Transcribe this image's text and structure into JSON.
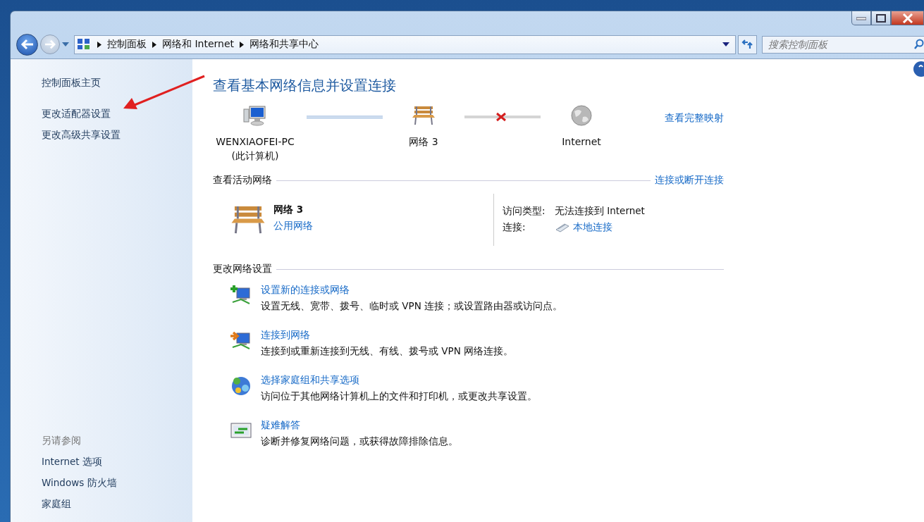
{
  "address_bar": {
    "breadcrumbs": [
      "控制面板",
      "网络和 Internet",
      "网络和共享中心"
    ],
    "search": {
      "placeholder": "搜索控制面板"
    }
  },
  "sidebar": {
    "links": [
      "控制面板主页",
      "更改适配器设置",
      "更改高级共享设置"
    ],
    "see_also": {
      "heading": "另请参阅",
      "links": [
        "Internet 选项",
        "Windows 防火墙",
        "家庭组"
      ]
    }
  },
  "main": {
    "title": "查看基本网络信息并设置连接",
    "map": {
      "nodes": [
        {
          "kind": "computer",
          "label": "WENXIAOFEI-PC",
          "sublabel": "(此计算机)"
        },
        {
          "kind": "network",
          "label": "网络  3"
        },
        {
          "kind": "internet",
          "label": "Internet"
        }
      ],
      "links": [
        {
          "broken": false
        },
        {
          "broken": true
        }
      ],
      "full_map_link": "查看完整映射"
    },
    "active_networks": {
      "heading": "查看活动网络",
      "link": "连接或断开连接",
      "network_name": "网络  3",
      "network_type": "公用网络",
      "access_type_label": "访问类型:",
      "access_type_value": "无法连接到 Internet",
      "connection_label": "连接:",
      "connection_value": "本地连接"
    },
    "change_settings": {
      "heading": "更改网络设置",
      "tasks": [
        {
          "kind": "new-connection",
          "title": "设置新的连接或网络",
          "description": "设置无线、宽带、拨号、临时或 VPN 连接；或设置路由器或访问点。"
        },
        {
          "kind": "connect",
          "title": "连接到网络",
          "description": "连接到或重新连接到无线、有线、拨号或 VPN 网络连接。"
        },
        {
          "kind": "homegroup",
          "title": "选择家庭组和共享选项",
          "description": "访问位于其他网络计算机上的文件和打印机，或更改共享设置。"
        },
        {
          "kind": "troubleshoot",
          "title": "疑难解答",
          "description": "诊断并修复网络问题，或获得故障排除信息。"
        }
      ]
    }
  }
}
